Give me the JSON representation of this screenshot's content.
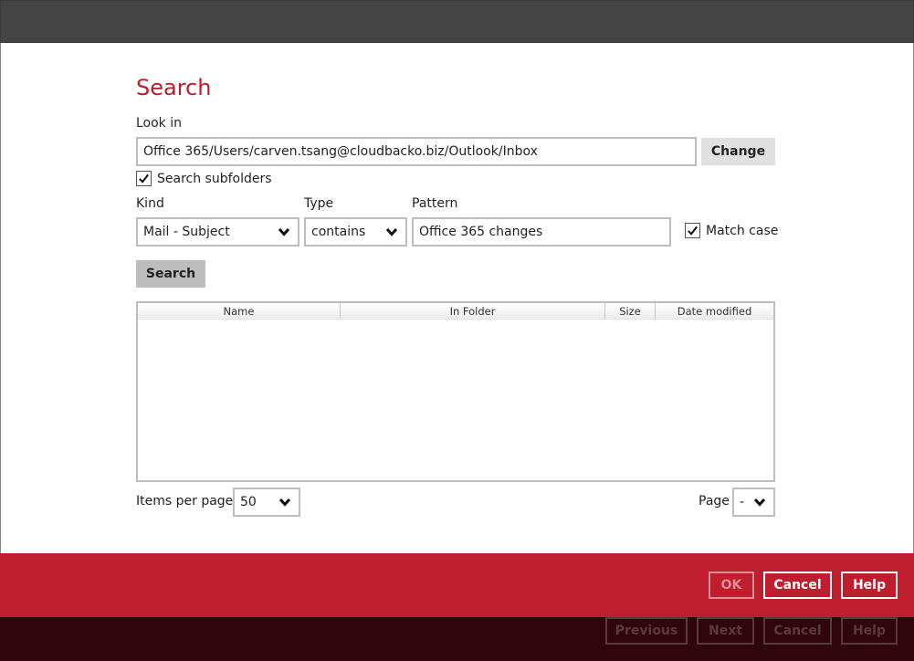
{
  "dialog": {
    "title": "Search",
    "look_in_label": "Look in",
    "look_in_value": "Office 365/Users/carven.tsang@cloudbacko.biz/Outlook/Inbox",
    "change_label": "Change",
    "search_subfolders_label": "Search subfolders",
    "search_subfolders_checked": true,
    "kind_label": "Kind",
    "kind_value": "Mail - Subject",
    "type_label": "Type",
    "type_value": "contains",
    "pattern_label": "Pattern",
    "pattern_value": "Office 365 changes",
    "match_case_label": "Match case",
    "match_case_checked": true,
    "search_button": "Search"
  },
  "results_table": {
    "columns": [
      "Name",
      "In Folder",
      "Size",
      "Date modified"
    ],
    "rows": []
  },
  "pagination": {
    "items_per_page_label": "Items per page",
    "items_per_page_value": "50",
    "page_label": "Page",
    "page_value": "-"
  },
  "dialog_buttons": {
    "ok": "OK",
    "cancel": "Cancel",
    "help": "Help"
  },
  "wizard_buttons": {
    "previous": "Previous",
    "next": "Next",
    "cancel": "Cancel",
    "help": "Help"
  },
  "colors": {
    "accent": "#be1e2d",
    "title_bar": "#444444",
    "footer_dark": "#2e060b"
  },
  "icons": [
    "check-icon",
    "chevron-down-icon"
  ]
}
